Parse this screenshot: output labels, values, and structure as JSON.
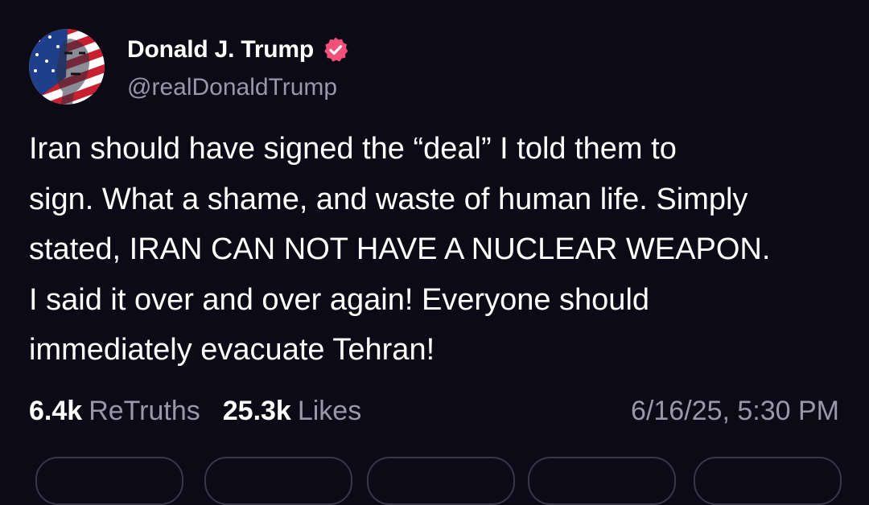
{
  "author": {
    "display_name": "Donald J. Trump",
    "handle": "@realDonaldTrump",
    "avatar_icon": "profile-avatar",
    "verified_icon": "verified-badge-icon",
    "verified_color": "#f0507a"
  },
  "post": {
    "lines": [
      "Iran should have signed the “deal” I told them to",
      "sign. What a shame, and waste of human life. Simply",
      "stated, IRAN CAN NOT HAVE A NUCLEAR WEAPON.",
      "I said it over and over again! Everyone should",
      "immediately evacuate Tehran!"
    ]
  },
  "stats": {
    "retruths_count": "6.4k",
    "retruths_label": "ReTruths",
    "likes_count": "25.3k",
    "likes_label": "Likes",
    "timestamp": "6/16/25, 5:30 PM"
  },
  "colors": {
    "background": "#0d0a17",
    "text": "#ffffff",
    "muted": "#9a97a6"
  }
}
